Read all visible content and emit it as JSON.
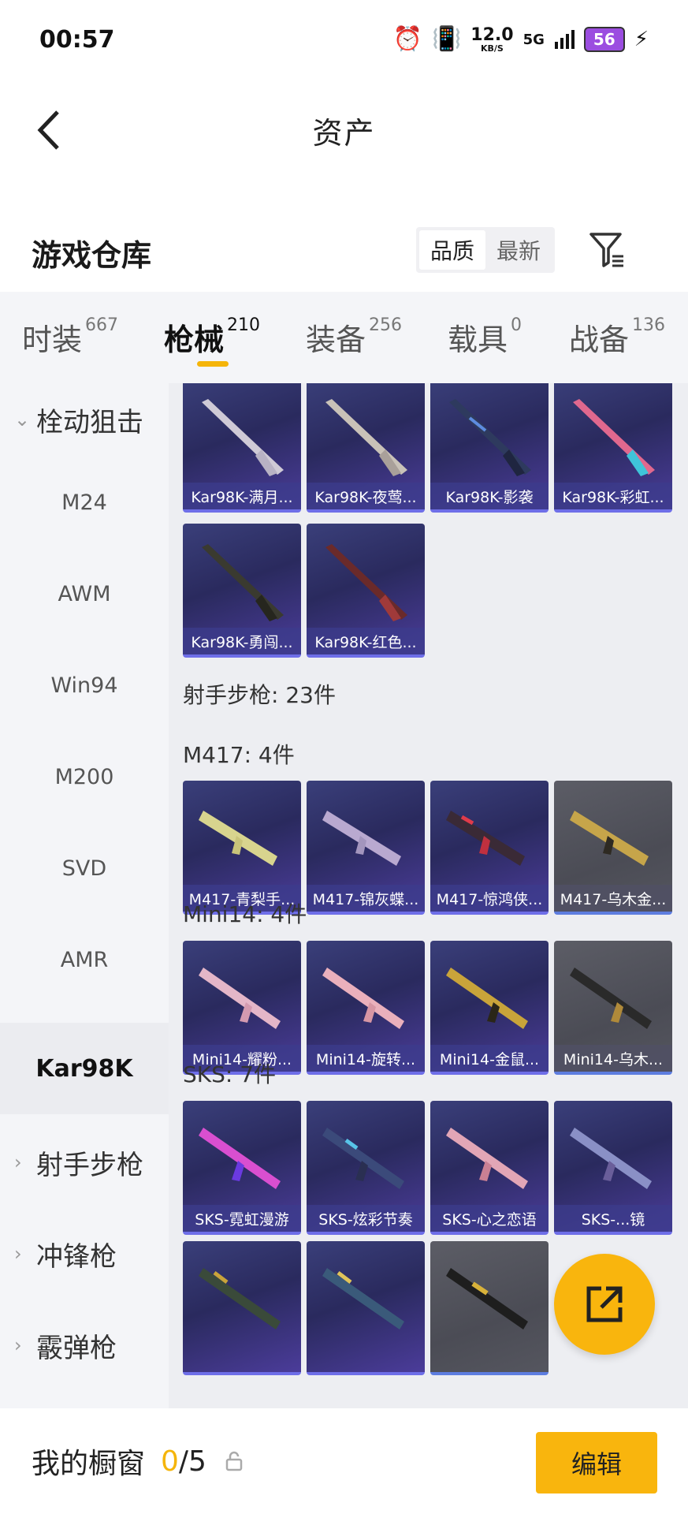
{
  "status": {
    "time": "00:57",
    "net_speed": "12.0",
    "net_unit": "KB/S",
    "net_type": "5G",
    "battery": "56"
  },
  "nav": {
    "title": "资产"
  },
  "warehouse": {
    "title": "游戏仓库",
    "sort_quality": "品质",
    "sort_newest": "最新"
  },
  "tabs": [
    {
      "label": "时装",
      "count": "667"
    },
    {
      "label": "枪械",
      "count": "210"
    },
    {
      "label": "装备",
      "count": "256"
    },
    {
      "label": "载具",
      "count": "0"
    },
    {
      "label": "战备",
      "count": "136"
    }
  ],
  "sidebar": {
    "group_bolt": "栓动狙击",
    "items": [
      "M24",
      "AWM",
      "Win94",
      "M200",
      "SVD",
      "AMR",
      "Kar98K"
    ],
    "group_marksman": "射手步枪",
    "group_smg": "冲锋枪",
    "group_shotgun": "霰弹枪"
  },
  "content": {
    "kar_cards": [
      "Kar98K-满月...",
      "Kar98K-夜莺...",
      "Kar98K-影袭",
      "Kar98K-彩虹...",
      "Kar98K-勇闯...",
      "Kar98K-红色..."
    ],
    "marksman_label": "射手步枪: 23件",
    "m417_label": "M417: 4件",
    "m417_cards": [
      "M417-青梨手...",
      "M417-锦灰蝶...",
      "M417-惊鸿侠...",
      "M417-乌木金..."
    ],
    "mini14_label": "Mini14: 4件",
    "mini14_cards": [
      "Mini14-耀粉...",
      "Mini14-旋转...",
      "Mini14-金鼠...",
      "Mini14-乌木..."
    ],
    "sks_label": "SKS: 7件",
    "sks_cards": [
      "SKS-霓虹漫游",
      "SKS-炫彩节奏",
      "SKS-心之恋语",
      "SKS-...镜"
    ]
  },
  "bottom": {
    "label": "我的橱窗",
    "current": "0",
    "total": "/5",
    "edit": "编辑"
  },
  "colors": {
    "accent": "#f9b50d",
    "card_purple": "#3a3f7a",
    "card_grey": "#55565f"
  }
}
